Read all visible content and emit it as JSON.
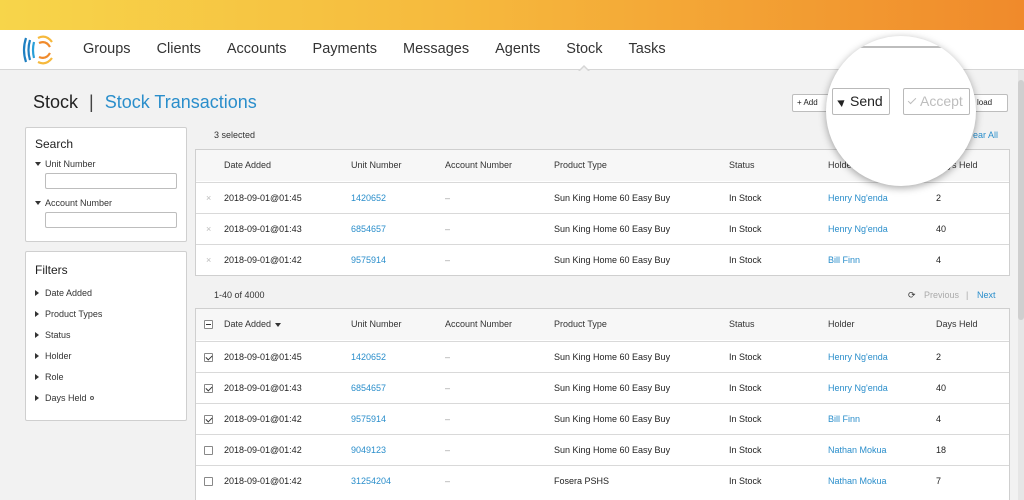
{
  "nav": {
    "items": [
      "Groups",
      "Clients",
      "Accounts",
      "Payments",
      "Messages",
      "Agents",
      "Stock",
      "Tasks"
    ],
    "active": "Stock"
  },
  "header": {
    "title": "Stock",
    "subtitle": "Stock Transactions"
  },
  "toolbar": {
    "add_label": "+ Add",
    "send_label": "Send",
    "accept_label": "Accept",
    "download_label": "load"
  },
  "search": {
    "title": "Search",
    "unit_number_label": "Unit Number",
    "account_number_label": "Account Number"
  },
  "filters": {
    "title": "Filters",
    "items": [
      "Date Added",
      "Product Types",
      "Status",
      "Holder",
      "Role",
      "Days Held"
    ]
  },
  "selected": {
    "count_text": "3 selected",
    "clear_all_label": "ear All"
  },
  "columns": [
    "Date Added",
    "Unit Number",
    "Account Number",
    "Product Type",
    "Status",
    "Holder",
    "Days Held"
  ],
  "selected_rows": [
    {
      "date": "2018-09-01@01:45",
      "unit": "1420652",
      "account": "–",
      "product": "Sun King Home 60 Easy Buy",
      "status": "In Stock",
      "holder": "Henry Ng'enda",
      "days": "2"
    },
    {
      "date": "2018-09-01@01:43",
      "unit": "6854657",
      "account": "–",
      "product": "Sun King Home 60 Easy Buy",
      "status": "In Stock",
      "holder": "Henry Ng'enda",
      "days": "40"
    },
    {
      "date": "2018-09-01@01:42",
      "unit": "9575914",
      "account": "–",
      "product": "Sun King Home 60 Easy Buy",
      "status": "In Stock",
      "holder": "Bill Finn",
      "days": "4"
    }
  ],
  "pagination": {
    "range_text": "1-40 of 4000",
    "previous_label": "Previous",
    "separator": "|",
    "next_label": "Next"
  },
  "rows": [
    {
      "checked": true,
      "date": "2018-09-01@01:45",
      "unit": "1420652",
      "account": "–",
      "product": "Sun King Home 60 Easy Buy",
      "status": "In Stock",
      "holder": "Henry Ng'enda",
      "days": "2"
    },
    {
      "checked": true,
      "date": "2018-09-01@01:43",
      "unit": "6854657",
      "account": "–",
      "product": "Sun King Home 60 Easy Buy",
      "status": "In Stock",
      "holder": "Henry Ng'enda",
      "days": "40"
    },
    {
      "checked": true,
      "date": "2018-09-01@01:42",
      "unit": "9575914",
      "account": "–",
      "product": "Sun King Home 60 Easy Buy",
      "status": "In Stock",
      "holder": "Bill Finn",
      "days": "4"
    },
    {
      "checked": false,
      "date": "2018-09-01@01:42",
      "unit": "9049123",
      "account": "–",
      "product": "Sun King Home 60 Easy Buy",
      "status": "In Stock",
      "holder": "Nathan Mokua",
      "days": "18"
    },
    {
      "checked": false,
      "date": "2018-09-01@01:42",
      "unit": "31254204",
      "account": "–",
      "product": "Fosera PSHS",
      "status": "In Stock",
      "holder": "Nathan Mokua",
      "days": "7"
    }
  ],
  "colors": {
    "accent": "#2a8ecb",
    "top_bar_start": "#f7d54a",
    "top_bar_end": "#f08a2b"
  }
}
